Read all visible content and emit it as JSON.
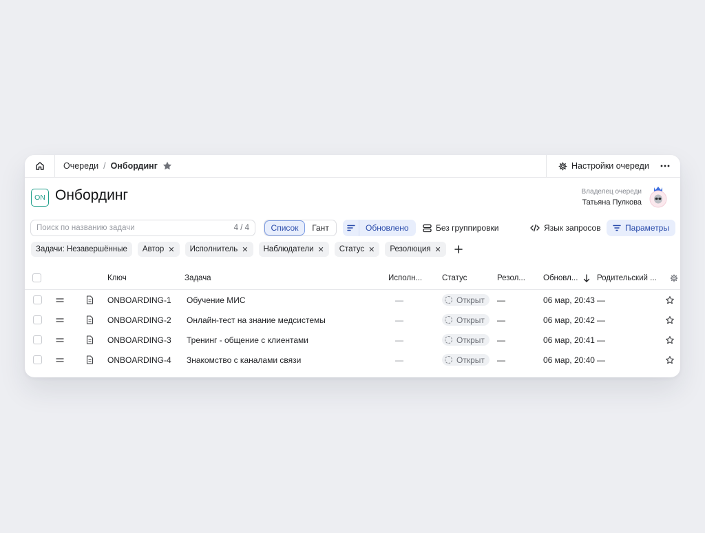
{
  "breadcrumb": {
    "parent": "Очереди",
    "separator": "/",
    "current": "Онбординг"
  },
  "topbar": {
    "settings_label": "Настройки очереди",
    "more_label": "···"
  },
  "header": {
    "badge": "ON",
    "title": "Онбординг",
    "owner_label": "Владелец очереди",
    "owner_name": "Татьяна Пулкова"
  },
  "toolbar": {
    "search_placeholder": "Поиск по названию задачи",
    "search_count": "4 / 4",
    "view_list": "Список",
    "view_gantt": "Гант",
    "sort_label": "Обновлено",
    "group_label": "Без группировки",
    "query_label": "Язык запросов",
    "params_label": "Параметры"
  },
  "filters": [
    {
      "label": "Задачи: Незавершённые",
      "removable": false
    },
    {
      "label": "Автор",
      "removable": true
    },
    {
      "label": "Исполнитель",
      "removable": true
    },
    {
      "label": "Наблюдатели",
      "removable": true
    },
    {
      "label": "Статус",
      "removable": true
    },
    {
      "label": "Резолюция",
      "removable": true
    }
  ],
  "table": {
    "columns": {
      "key": "Ключ",
      "task": "Задача",
      "assignee": "Исполн...",
      "status": "Статус",
      "resolution": "Резол...",
      "updated": "Обновл...",
      "parent": "Родительский ..."
    },
    "rows": [
      {
        "key": "ONBOARDING-1",
        "task": "Обучение МИС",
        "assignee": "—",
        "status": "Открыт",
        "resolution": "—",
        "updated": "06 мар, 20:43",
        "parent": "—"
      },
      {
        "key": "ONBOARDING-2",
        "task": "Онлайн-тест на знание медсистемы",
        "assignee": "—",
        "status": "Открыт",
        "resolution": "—",
        "updated": "06 мар, 20:42",
        "parent": "—"
      },
      {
        "key": "ONBOARDING-3",
        "task": "Тренинг - общение с клиентами",
        "assignee": "—",
        "status": "Открыт",
        "resolution": "—",
        "updated": "06 мар, 20:41",
        "parent": "—"
      },
      {
        "key": "ONBOARDING-4",
        "task": "Знакомство с каналами связи",
        "assignee": "—",
        "status": "Открыт",
        "resolution": "—",
        "updated": "06 мар, 20:40",
        "parent": "—"
      }
    ]
  },
  "colors": {
    "accent": "#2b4cab",
    "accent_bg": "#e8eefc",
    "badge": "#1f9e8a",
    "background": "#edeef2"
  }
}
